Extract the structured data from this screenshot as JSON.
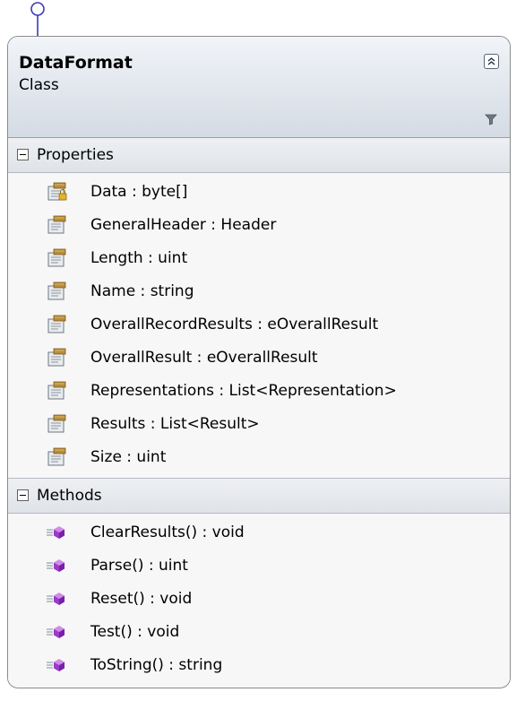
{
  "class": {
    "name": "DataFormat",
    "kind": "Class"
  },
  "sections": {
    "properties": {
      "label": "Properties",
      "items": [
        {
          "text": "Data : byte[]",
          "icon": "property-lock-icon"
        },
        {
          "text": "GeneralHeader : Header",
          "icon": "property-icon"
        },
        {
          "text": "Length : uint",
          "icon": "property-icon"
        },
        {
          "text": "Name : string",
          "icon": "property-icon"
        },
        {
          "text": "OverallRecordResults : eOverallResult",
          "icon": "property-icon"
        },
        {
          "text": "OverallResult : eOverallResult",
          "icon": "property-icon"
        },
        {
          "text": "Representations : List<Representation>",
          "icon": "property-icon"
        },
        {
          "text": "Results : List<Result>",
          "icon": "property-icon"
        },
        {
          "text": "Size : uint",
          "icon": "property-icon"
        }
      ]
    },
    "methods": {
      "label": "Methods",
      "items": [
        {
          "text": "ClearResults() : void",
          "icon": "method-icon"
        },
        {
          "text": "Parse() : uint",
          "icon": "method-icon"
        },
        {
          "text": "Reset() : void",
          "icon": "method-icon"
        },
        {
          "text": "Test() : void",
          "icon": "method-icon"
        },
        {
          "text": "ToString() : string",
          "icon": "method-icon"
        }
      ]
    }
  },
  "icons": {
    "interface": "interface-lollipop-icon",
    "collapse": "collapse-icon",
    "filter": "filter-icon"
  },
  "colors": {
    "border": "#8c8c8c",
    "header_top": "#f1f4f8",
    "header_bottom": "#d4dbe4",
    "method_purple": "#9b3bc9",
    "interface_stroke": "#3b3bb8"
  }
}
